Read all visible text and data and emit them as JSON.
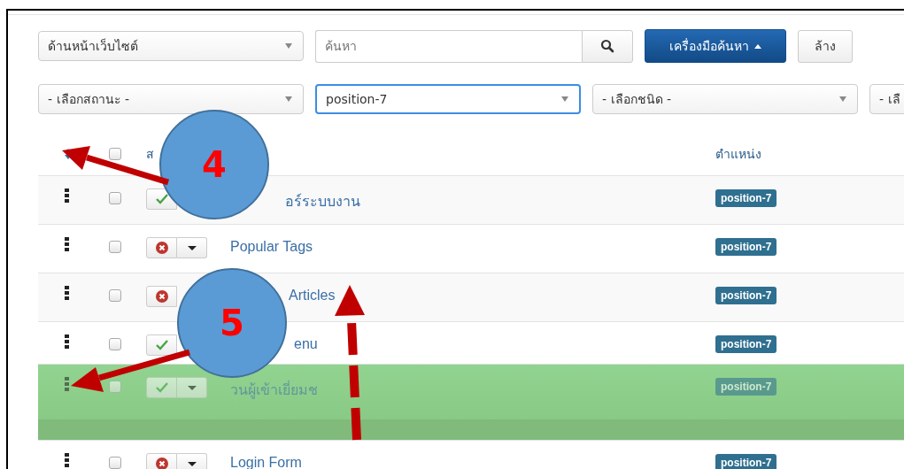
{
  "filters": {
    "client": "ด้านหน้าเว็บไซต์",
    "search_placeholder": "ค้นหา",
    "search_tools": "เครื่องมือค้นหา",
    "clear": "ล้าง",
    "selects": [
      {
        "value": "- เลือกสถานะ -",
        "focused": false
      },
      {
        "value": "position-7",
        "focused": true
      },
      {
        "value": "- เลือกชนิด -",
        "focused": false
      },
      {
        "value": "- เลื",
        "focused": false
      }
    ]
  },
  "table": {
    "header": {
      "status": "ส",
      "position": "ตำแหน่ง",
      "checked": false
    },
    "rows": [
      {
        "title": "อร์ระบบงาน",
        "published": true,
        "checked": false,
        "dragging": false,
        "position": "position-7"
      },
      {
        "title": "Popular Tags",
        "published": false,
        "checked": false,
        "dragging": false,
        "position": "position-7"
      },
      {
        "title": "Articles",
        "published": false,
        "checked": false,
        "dragging": false,
        "position": "position-7"
      },
      {
        "title": "enu",
        "published": true,
        "checked": false,
        "dragging": false,
        "position": "position-7"
      },
      {
        "title": "วนผู้เข้าเยี่ยมช",
        "published": true,
        "checked": false,
        "dragging": true,
        "position": "position-7"
      },
      {
        "title": "Login Form",
        "published": false,
        "checked": false,
        "dragging": false,
        "position": "position-7"
      }
    ]
  },
  "callouts": [
    {
      "number": "4"
    },
    {
      "number": "5"
    }
  ]
}
